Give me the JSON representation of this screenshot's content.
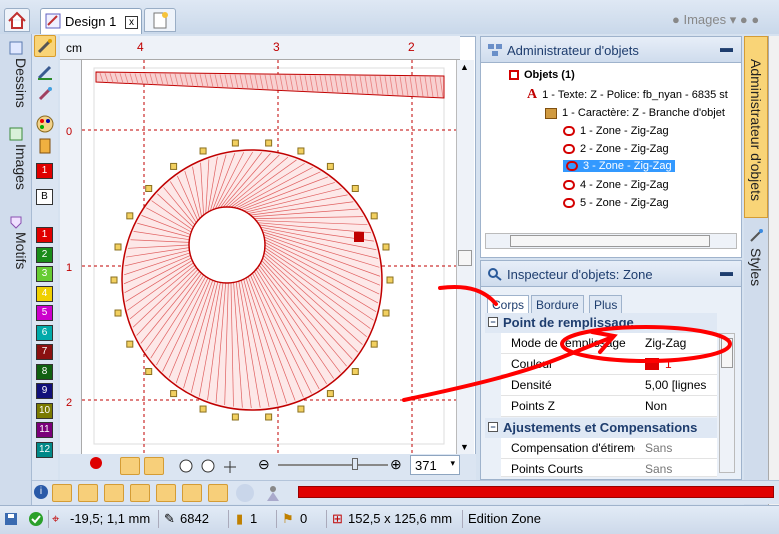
{
  "tabs": {
    "design_label": "Design 1",
    "close_glyph": "x",
    "images_label": "Images"
  },
  "left_tabs": [
    "Dessins",
    "Images",
    "Motifs"
  ],
  "palette": {
    "numbers": [
      "1",
      "2",
      "3",
      "4",
      "5",
      "6",
      "7",
      "8",
      "9",
      "10",
      "11",
      "12"
    ],
    "colors": [
      "#e00000",
      "#1a8c1a",
      "#66cc33",
      "#f0d000",
      "#cc00cc",
      "#00aaaa",
      "#8a1010",
      "#106010",
      "#10107a",
      "#7a7a00",
      "#7a007a",
      "#008888"
    ],
    "selected_box": "1",
    "b_box": "B"
  },
  "ruler": {
    "unit": "cm",
    "h_marks": [
      "4",
      "3",
      "2"
    ],
    "v_marks": [
      "0",
      "1",
      "2"
    ]
  },
  "zoom": {
    "value": "371"
  },
  "object_manager": {
    "title": "Administrateur d'objets",
    "rows": [
      {
        "label": "Objets (1)"
      },
      {
        "label": "1 - Texte: Z - Police: fb_nyan - 6835 st"
      },
      {
        "label": "1 - Caractère: Z - Branche d'objet"
      },
      {
        "label": "1 - Zone - Zig-Zag"
      },
      {
        "label": "2 - Zone - Zig-Zag"
      },
      {
        "label": "3 - Zone - Zig-Zag"
      },
      {
        "label": "4 - Zone - Zig-Zag"
      },
      {
        "label": "5 - Zone - Zig-Zag"
      }
    ]
  },
  "inspector": {
    "title": "Inspecteur d'objets: Zone",
    "tabs": [
      "Corps",
      "Bordure",
      "Plus"
    ],
    "section1": "Point de remplissage",
    "props1": [
      {
        "key": "Mode de remplissage",
        "value": "Zig-Zag"
      },
      {
        "key": "Couleur",
        "value": "1"
      },
      {
        "key": "Densité",
        "value": "5,00 [lignes"
      },
      {
        "key": "Points Z",
        "value": "Non"
      }
    ],
    "section2": "Ajustements et Compensations",
    "props2": [
      {
        "key": "Compensation d'étirement",
        "value": "Sans"
      },
      {
        "key": "Points Courts",
        "value": "Sans"
      }
    ]
  },
  "right_tabs": [
    "Administrateur d'objets",
    "Styles"
  ],
  "status": {
    "coords": "-19,5; 1,1 mm",
    "stitches": "6842",
    "count1": "1",
    "count2": "0",
    "size": "152,5 x 125,6 mm",
    "mode": "Edition Zone"
  },
  "colors": {
    "accent": "#f9d477",
    "highlight": "#3399ff",
    "stitch": "#d40000",
    "annotation": "#ff0000"
  }
}
